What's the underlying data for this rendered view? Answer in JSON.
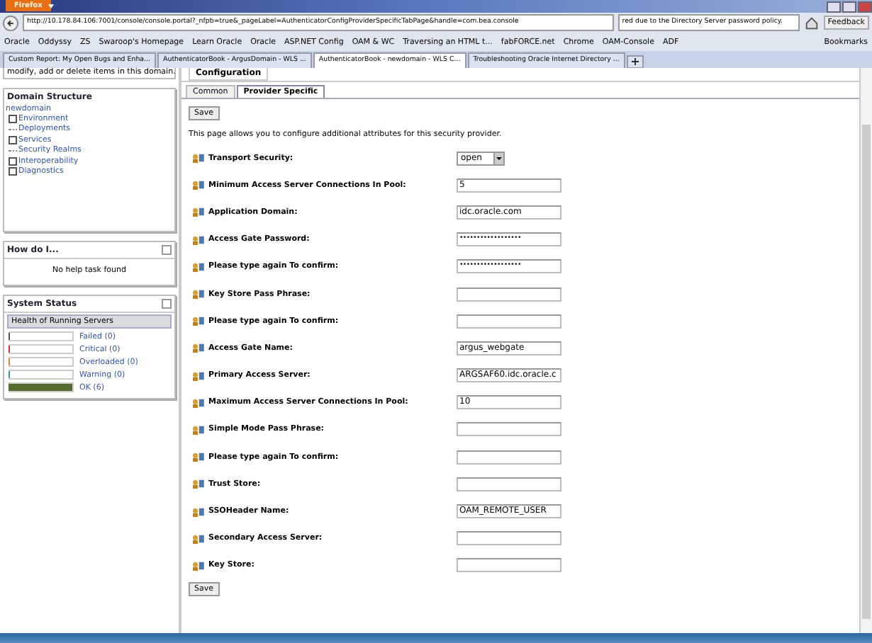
{
  "browser": {
    "menu_button": "Firefox",
    "url": "http://10.178.84.106:7001/console/console.portal?_nfpb=true&_pageLabel=AuthenticatorConfigProviderSpecificTabPage&handle=com.bea.console",
    "search": "red due to the Directory Server password policy.",
    "feedback": "Feedback",
    "bookmarks": [
      "Oracle",
      "Oddyssy",
      "ZS",
      "Swaroop's Homepage",
      "Learn Oracle",
      "Oracle",
      "ASP.NET Config",
      "OAM & WC",
      "Traversing an HTML t...",
      "fabFORCE.net",
      "Chrome",
      "OAM-Console",
      "ADF"
    ],
    "bookmarks_menu": "Bookmarks",
    "tabs": [
      {
        "label": "Custom Report: My Open Bugs and Enha...",
        "selected": false
      },
      {
        "label": "AuthenticatorBook - ArgusDomain - WLS ...",
        "selected": false
      },
      {
        "label": "AuthenticatorBook - newdomain - WLS C...",
        "selected": true
      },
      {
        "label": "Troubleshooting Oracle Internet Directory ...",
        "selected": false
      }
    ]
  },
  "sidebar": {
    "intro": "modify, add or delete items in this domain.",
    "domain_structure": {
      "title": "Domain Structure",
      "root": "newdomain",
      "children": [
        {
          "label": "Environment",
          "kind": "folder"
        },
        {
          "label": "Deployments",
          "kind": "leaf"
        },
        {
          "label": "Services",
          "kind": "folder"
        },
        {
          "label": "Security Realms",
          "kind": "leaf"
        },
        {
          "label": "Interoperability",
          "kind": "folder"
        },
        {
          "label": "Diagnostics",
          "kind": "folder"
        }
      ]
    },
    "how_do_i": {
      "title": "How do I...",
      "text": "No help task found"
    },
    "system_status": {
      "title": "System Status",
      "subtitle": "Health of Running Servers",
      "items": [
        {
          "label": "Failed (0)",
          "color": "#555555",
          "level": 0
        },
        {
          "label": "Critical (0)",
          "color": "#cc3333",
          "level": 0
        },
        {
          "label": "Overloaded (0)",
          "color": "#dd8833",
          "level": 0
        },
        {
          "label": "Warning (0)",
          "color": "#449999",
          "level": 0
        },
        {
          "label": "OK (6)",
          "color": "#556b2f",
          "level": 1
        }
      ]
    }
  },
  "main": {
    "header": "Configuration",
    "tabs": [
      {
        "label": "Common",
        "selected": false
      },
      {
        "label": "Provider Specific",
        "selected": true
      }
    ],
    "save": "Save",
    "description": "This page allows you to configure additional attributes for this security provider.",
    "fields": [
      {
        "label": "Transport Security:",
        "kind": "select",
        "value": "open"
      },
      {
        "label": "Minimum Access Server Connections In Pool:",
        "kind": "text",
        "value": "5"
      },
      {
        "label": "Application Domain:",
        "kind": "text",
        "value": "idc.oracle.com"
      },
      {
        "label": "Access Gate Password:",
        "kind": "password",
        "value": "••••••••••••••••••"
      },
      {
        "label": "Please type again To confirm:",
        "kind": "password",
        "value": "••••••••••••••••••"
      },
      {
        "label": "Key Store Pass Phrase:",
        "kind": "text"
      },
      {
        "label": "Please type again To confirm:",
        "kind": "text"
      },
      {
        "label": "Access Gate Name:",
        "kind": "text",
        "value": "argus_webgate"
      },
      {
        "label": "Primary Access Server:",
        "kind": "text",
        "value": "ARGSAF60.idc.oracle.c"
      },
      {
        "label": "Maximum Access Server Connections In Pool:",
        "kind": "text",
        "value": "10"
      },
      {
        "label": "Simple Mode Pass Phrase:",
        "kind": "text"
      },
      {
        "label": "Please type again To confirm:",
        "kind": "text"
      },
      {
        "label": "Trust Store:",
        "kind": "text"
      },
      {
        "label": "SSOHeader Name:",
        "kind": "text",
        "value": "OAM_REMOTE_USER"
      },
      {
        "label": "Secondary Access Server:",
        "kind": "text"
      },
      {
        "label": "Key Store:",
        "kind": "text"
      }
    ],
    "save_bottom": "Save"
  }
}
